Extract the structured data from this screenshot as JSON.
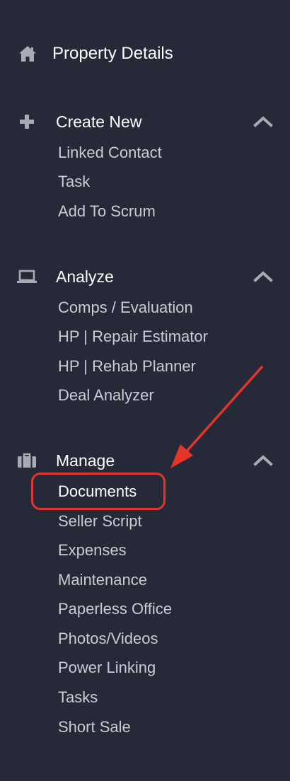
{
  "sidebar": {
    "home": {
      "label": "Property Details",
      "icon": "home-icon"
    },
    "sections": [
      {
        "label": "Create New",
        "icon": "plus-icon",
        "toggle_icon": "chevron-up-icon",
        "items": [
          "Linked Contact",
          "Task",
          "Add To Scrum"
        ]
      },
      {
        "label": "Analyze",
        "icon": "laptop-icon",
        "toggle_icon": "chevron-up-icon",
        "items": [
          "Comps / Evaluation",
          "HP | Repair Estimator",
          "HP | Rehab Planner",
          "Deal Analyzer"
        ]
      },
      {
        "label": "Manage",
        "icon": "briefcase-icon",
        "toggle_icon": "chevron-up-icon",
        "items": [
          "Documents",
          "Seller Script",
          "Expenses",
          "Maintenance",
          "Paperless Office",
          "Photos/Videos",
          "Power Linking",
          "Tasks",
          "Short Sale"
        ]
      }
    ],
    "active_item": "Documents"
  },
  "annotation": {
    "highlight": "Documents",
    "color": "#e5352b"
  },
  "colors": {
    "background": "#262a38",
    "heading_text": "#ffffff",
    "item_text": "#c9ccd4",
    "icon": "#a7abb5",
    "annotation": "#e5352b"
  }
}
